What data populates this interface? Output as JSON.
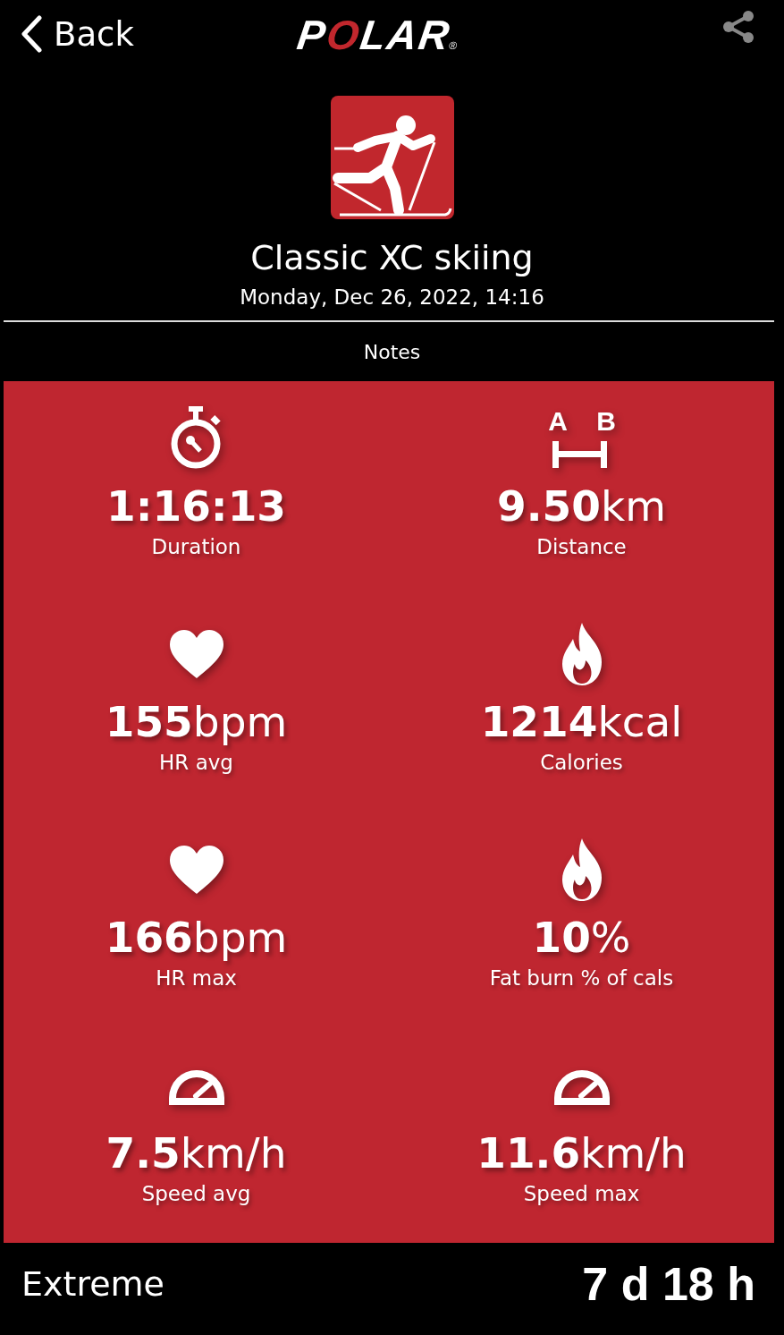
{
  "header": {
    "back_label": "Back",
    "logo": "POLAR",
    "registered_mark": "®"
  },
  "activity": {
    "title": "Classic XC skiing",
    "date": "Monday, Dec 26, 2022, 14:16"
  },
  "notes_label": "Notes",
  "stat_rows": [
    [
      {
        "kind": "stopwatch",
        "value": "1:16:13",
        "label": "Duration"
      },
      {
        "kind": "distance",
        "icon_labels": [
          "A",
          "B"
        ],
        "value": "9.50",
        "unit": "km",
        "label": "Distance"
      }
    ],
    [
      {
        "kind": "heart",
        "value": "155",
        "unit": "bpm",
        "label": "HR avg"
      },
      {
        "kind": "flame",
        "value": "1214",
        "unit": "kcal",
        "label": "Calories"
      }
    ],
    [
      {
        "kind": "heart",
        "value": "166",
        "unit": "bpm",
        "label": "HR max"
      },
      {
        "kind": "flame",
        "value": "10",
        "unit": "%",
        "label": "Fat burn % of cals"
      }
    ],
    [
      {
        "kind": "gauge",
        "value": "7.5",
        "unit": "km/h",
        "label": "Speed avg"
      },
      {
        "kind": "gauge",
        "value": "11.6",
        "unit": "km/h",
        "label": "Speed max"
      }
    ]
  ],
  "footer": {
    "zone": "Extreme",
    "recovery": "7 d 18 h"
  }
}
